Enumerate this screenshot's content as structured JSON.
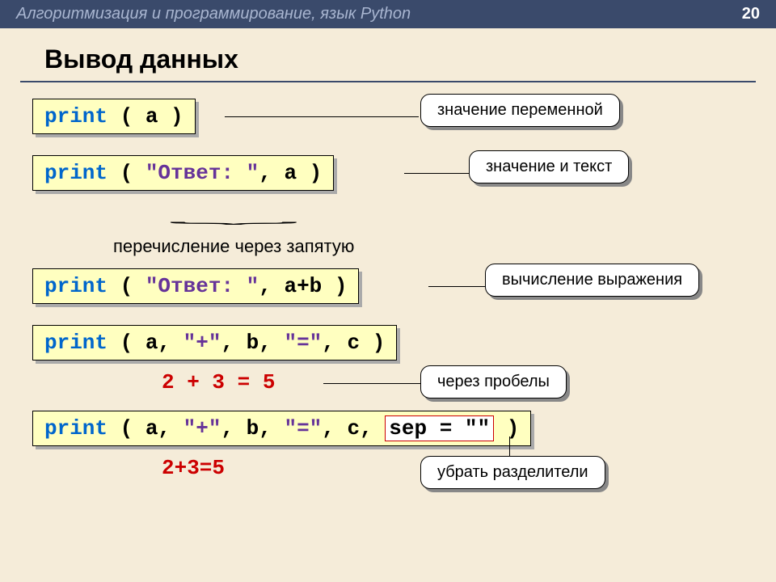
{
  "header": {
    "subject": "Алгоритмизация и программирование, язык Python",
    "page": "20"
  },
  "title": "Вывод данных",
  "rows": [
    {
      "code_kw": "print",
      "code_rest": " ( a )",
      "callout": "значение переменной"
    },
    {
      "code_kw": "print",
      "code_rest_pre": " ( ",
      "code_str": "\"Ответ: \"",
      "code_rest_post": ", a )",
      "callout": "значение и текст"
    }
  ],
  "note1": "перечисление через запятую",
  "row3": {
    "code_kw": "print",
    "code_pre": " ( ",
    "code_str": "\"Ответ: \"",
    "code_post": ", a+b )",
    "callout": "вычисление выражения"
  },
  "row4": {
    "code_kw": "print",
    "code_pre": " ( a, ",
    "code_str1": "\"+\"",
    "code_mid": ", b, ",
    "code_str2": "\"=\"",
    "code_post": ", c )",
    "output": "2 + 3 = 5",
    "callout": "через пробелы"
  },
  "row5": {
    "code_kw": "print",
    "code_pre": " ( a, ",
    "code_str1": "\"+\"",
    "code_mid": ", b, ",
    "code_str2": "\"=\"",
    "code_post1": ", c, ",
    "sep": "sep = \"\"",
    "code_post2": " )",
    "output": "2+3=5",
    "callout": "убрать разделители"
  }
}
